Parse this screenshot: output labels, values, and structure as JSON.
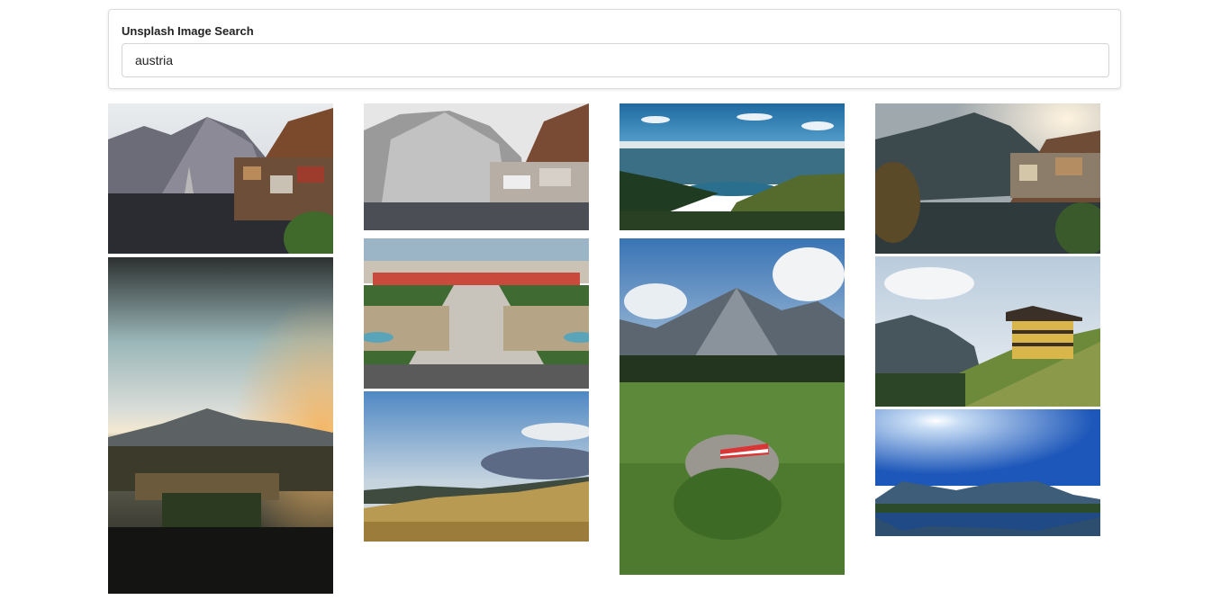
{
  "search": {
    "label": "Unsplash Image Search",
    "value": "austria"
  },
  "photos": [
    {
      "name": "hallstatt-lake-village-photo"
    },
    {
      "name": "cloudy-sunset-valley-town-photo"
    },
    {
      "name": "snowy-hallstatt-photo"
    },
    {
      "name": "belvedere-palace-gardens-photo"
    },
    {
      "name": "grassy-field-blue-sky-photo"
    },
    {
      "name": "alpine-lake-panorama-photo"
    },
    {
      "name": "mountain-meadow-flag-rock-photo"
    },
    {
      "name": "hallstatt-sunlight-photo"
    },
    {
      "name": "mountain-chalet-photo"
    },
    {
      "name": "sunny-lake-reflection-photo"
    }
  ]
}
